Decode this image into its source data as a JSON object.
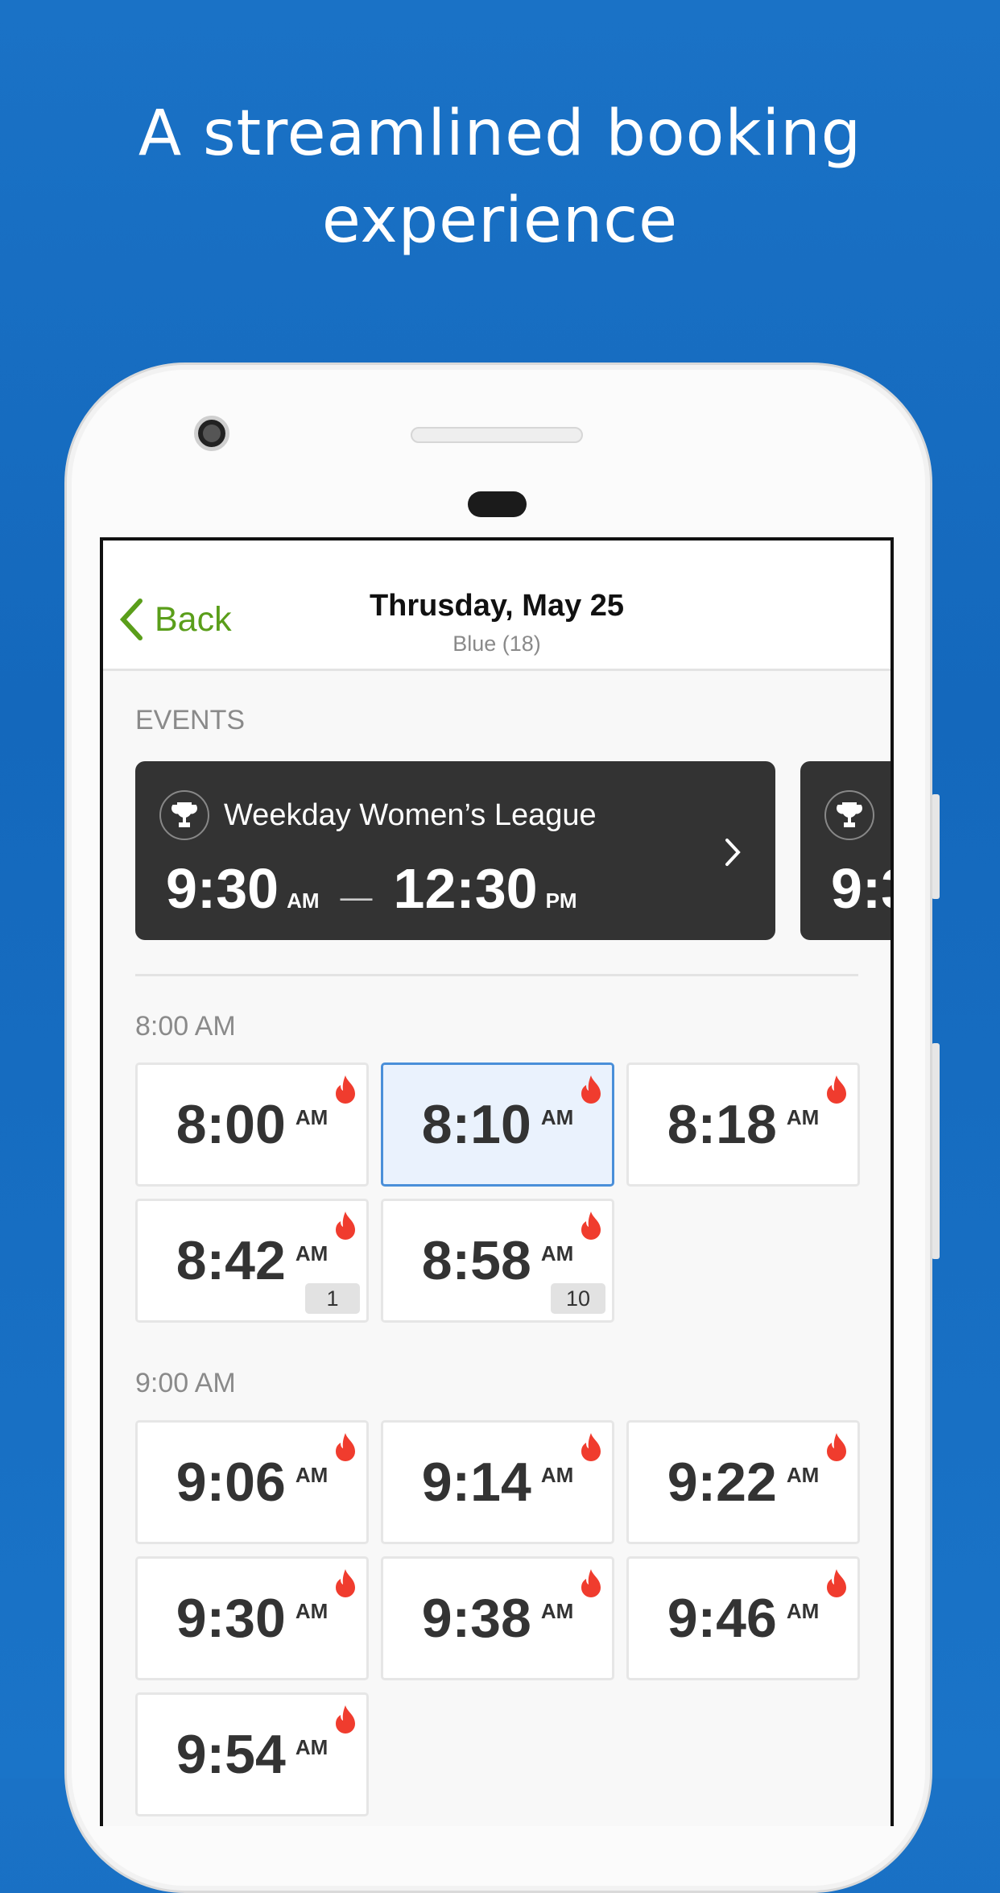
{
  "headline": {
    "line1": "A streamlined booking",
    "line2": "experience"
  },
  "nav": {
    "back_label": "Back",
    "title": "Thrusday, May 25",
    "subtitle": "Blue (18)"
  },
  "events": {
    "heading": "EVENTS",
    "cards": [
      {
        "title": "Weekday Women’s League",
        "start": "9:30",
        "start_period": "AM",
        "end": "12:30",
        "end_period": "PM",
        "icon": "trophy-icon"
      },
      {
        "title": "",
        "start": "9:3",
        "icon": "trophy-icon"
      }
    ]
  },
  "colors": {
    "accent_green": "#5a9e1a",
    "selected_border": "#4a8fd9",
    "flame": "#f03c2e",
    "background_blue": "#1570c4"
  },
  "sections": [
    {
      "label": "8:00 AM",
      "slots": [
        {
          "time": "8:00",
          "period": "AM",
          "hot": true
        },
        {
          "time": "8:10",
          "period": "AM",
          "hot": true,
          "selected": true
        },
        {
          "time": "8:18",
          "period": "AM",
          "hot": true
        },
        {
          "time": "8:42",
          "period": "AM",
          "hot": true,
          "badge": "1"
        },
        {
          "time": "8:58",
          "period": "AM",
          "hot": true,
          "badge": "10"
        }
      ]
    },
    {
      "label": "9:00 AM",
      "slots": [
        {
          "time": "9:06",
          "period": "AM",
          "hot": true
        },
        {
          "time": "9:14",
          "period": "AM",
          "hot": true
        },
        {
          "time": "9:22",
          "period": "AM",
          "hot": true
        },
        {
          "time": "9:30",
          "period": "AM",
          "hot": true
        },
        {
          "time": "9:38",
          "period": "AM",
          "hot": true
        },
        {
          "time": "9:46",
          "period": "AM",
          "hot": true
        },
        {
          "time": "9:54",
          "period": "AM",
          "hot": true
        }
      ]
    }
  ]
}
